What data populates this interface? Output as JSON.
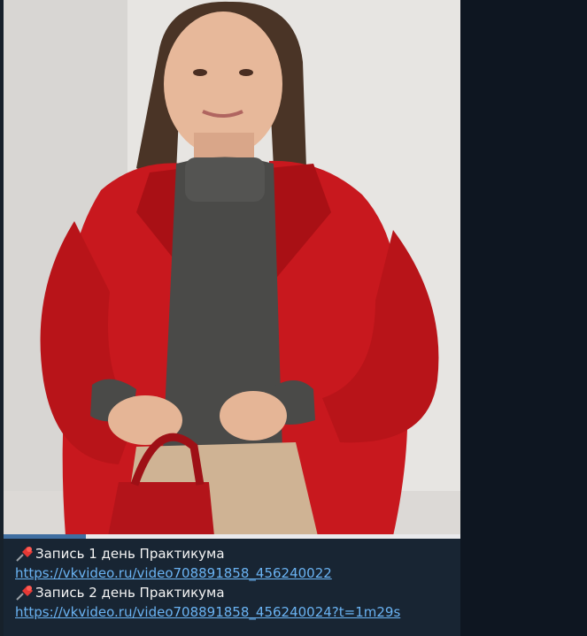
{
  "message": {
    "media": {
      "type": "video-preview",
      "description_icon": "video-thumbnail",
      "progress_fraction": 0.18
    },
    "caption": {
      "line1_text": "Запись 1 день Практикума",
      "line1_link": "https://vkvideo.ru/video708891858_456240022",
      "line2_text": "Запись 2 день Практикума",
      "line2_link": "https://vkvideo.ru/video708891858_456240024?t=1m29s",
      "pin_icon": "pushpin-icon"
    }
  },
  "colors": {
    "chat_background": "#0e1621",
    "bubble": "#182533",
    "link": "#6ab3f3",
    "progress": "#3f6ea1",
    "coat": "#c8181e",
    "sweater": "#4a4a48"
  }
}
